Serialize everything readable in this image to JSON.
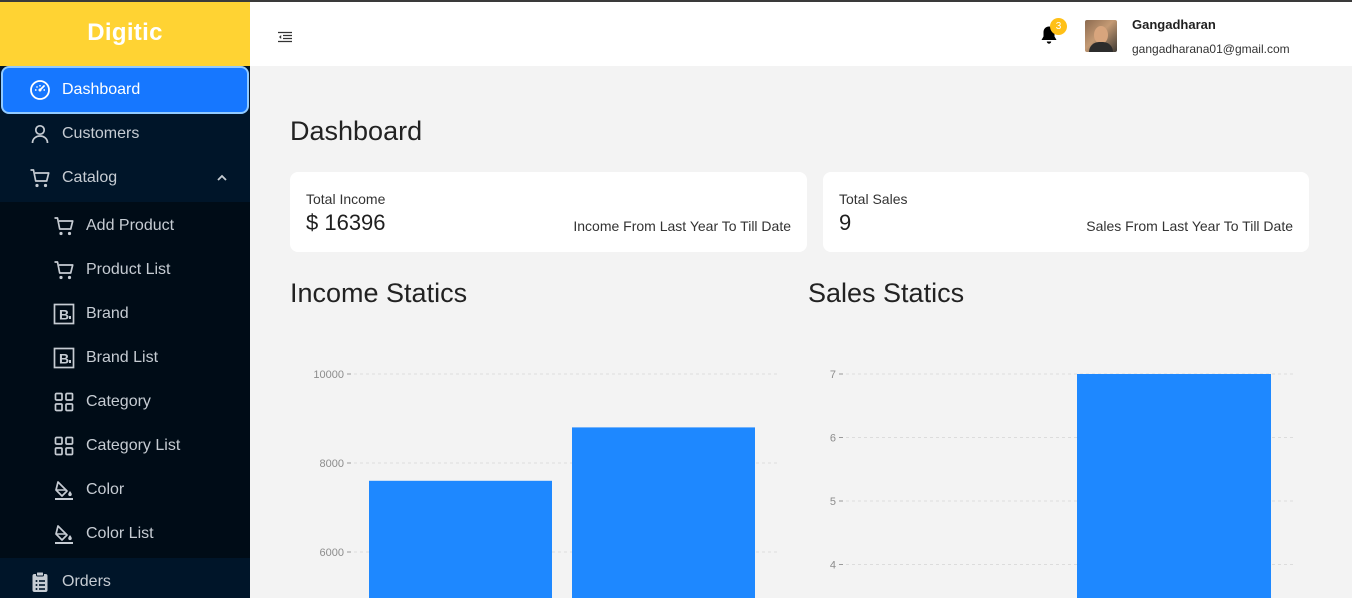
{
  "app": {
    "logo": "Digitic"
  },
  "sidebar": {
    "items": [
      {
        "label": "Dashboard"
      },
      {
        "label": "Customers"
      },
      {
        "label": "Catalog"
      },
      {
        "label": "Add Product"
      },
      {
        "label": "Product List"
      },
      {
        "label": "Brand"
      },
      {
        "label": "Brand List"
      },
      {
        "label": "Category"
      },
      {
        "label": "Category List"
      },
      {
        "label": "Color"
      },
      {
        "label": "Color List"
      },
      {
        "label": "Orders"
      }
    ]
  },
  "header": {
    "notification_count": "3",
    "user_name": "Gangadharan",
    "user_email": "gangadharana01@gmail.com"
  },
  "main": {
    "title": "Dashboard",
    "cards": [
      {
        "title": "Total Income",
        "value": "$ 16396",
        "subtitle": "Income From Last Year To Till Date"
      },
      {
        "title": "Total Sales",
        "value": "9",
        "subtitle": "Sales From Last Year To Till Date"
      }
    ],
    "income_title": "Income Statics",
    "sales_title": "Sales Statics"
  },
  "colors": {
    "accent": "#1677ff",
    "bar": "#1e88ff",
    "logo_bg": "#ffd333",
    "sidebar_bg": "#001529"
  },
  "chart_data": [
    {
      "type": "bar",
      "title": "Income Statics",
      "categories": [
        "",
        ""
      ],
      "values": [
        7600,
        8800
      ],
      "yticks": [
        "10000",
        "8000",
        "6000"
      ],
      "ylim": [
        5000,
        10000
      ],
      "grid": true
    },
    {
      "type": "bar",
      "title": "Sales Statics",
      "categories": [
        ""
      ],
      "values": [
        7
      ],
      "yticks": [
        "7",
        "6",
        "5",
        "4"
      ],
      "ylim": [
        3,
        7
      ],
      "grid": true
    }
  ]
}
